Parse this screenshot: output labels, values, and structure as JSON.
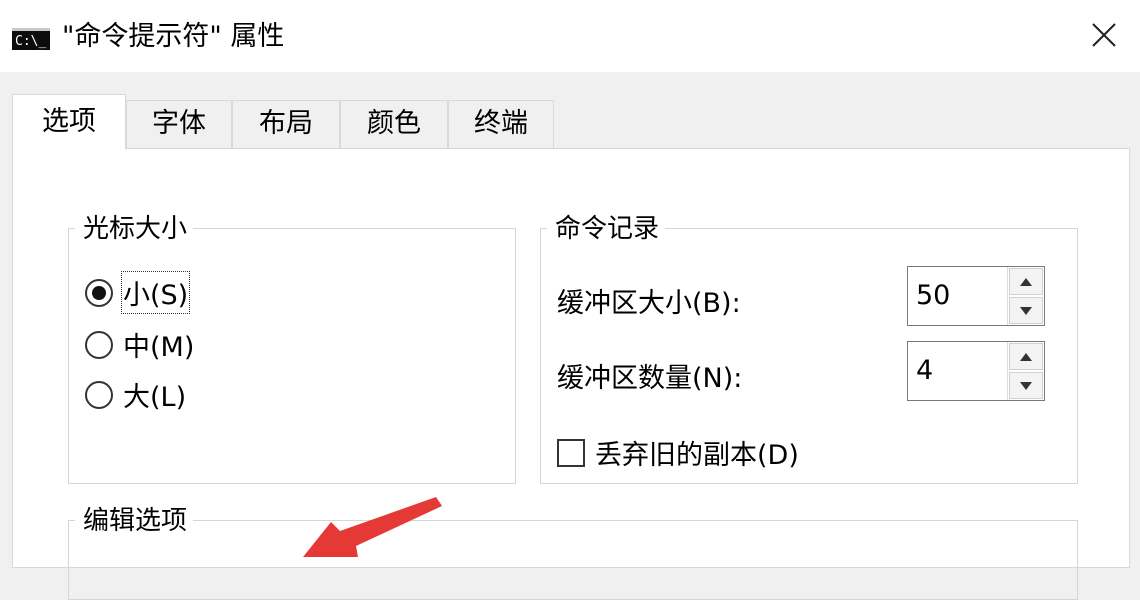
{
  "window": {
    "icon_text": "C:\\_",
    "title": "\"命令提示符\" 属性",
    "close_glyph": "✕"
  },
  "tabs": [
    {
      "label": "选项",
      "active": true
    },
    {
      "label": "字体"
    },
    {
      "label": "布局"
    },
    {
      "label": "颜色"
    },
    {
      "label": "终端"
    }
  ],
  "cursor_size": {
    "title": "光标大小",
    "options": [
      {
        "label": "小(S)",
        "selected": true
      },
      {
        "label": "中(M)"
      },
      {
        "label": "大(L)"
      }
    ]
  },
  "command_history": {
    "title": "命令记录",
    "buffer_size_label": "缓冲区大小(B):",
    "buffer_size_value": "50",
    "buffer_count_label": "缓冲区数量(N):",
    "buffer_count_value": "4",
    "discard_old_label": "丢弃旧的副本(D)"
  },
  "edit_options": {
    "title": "编辑选项"
  },
  "colors": {
    "annotation_arrow": "#e53935"
  }
}
